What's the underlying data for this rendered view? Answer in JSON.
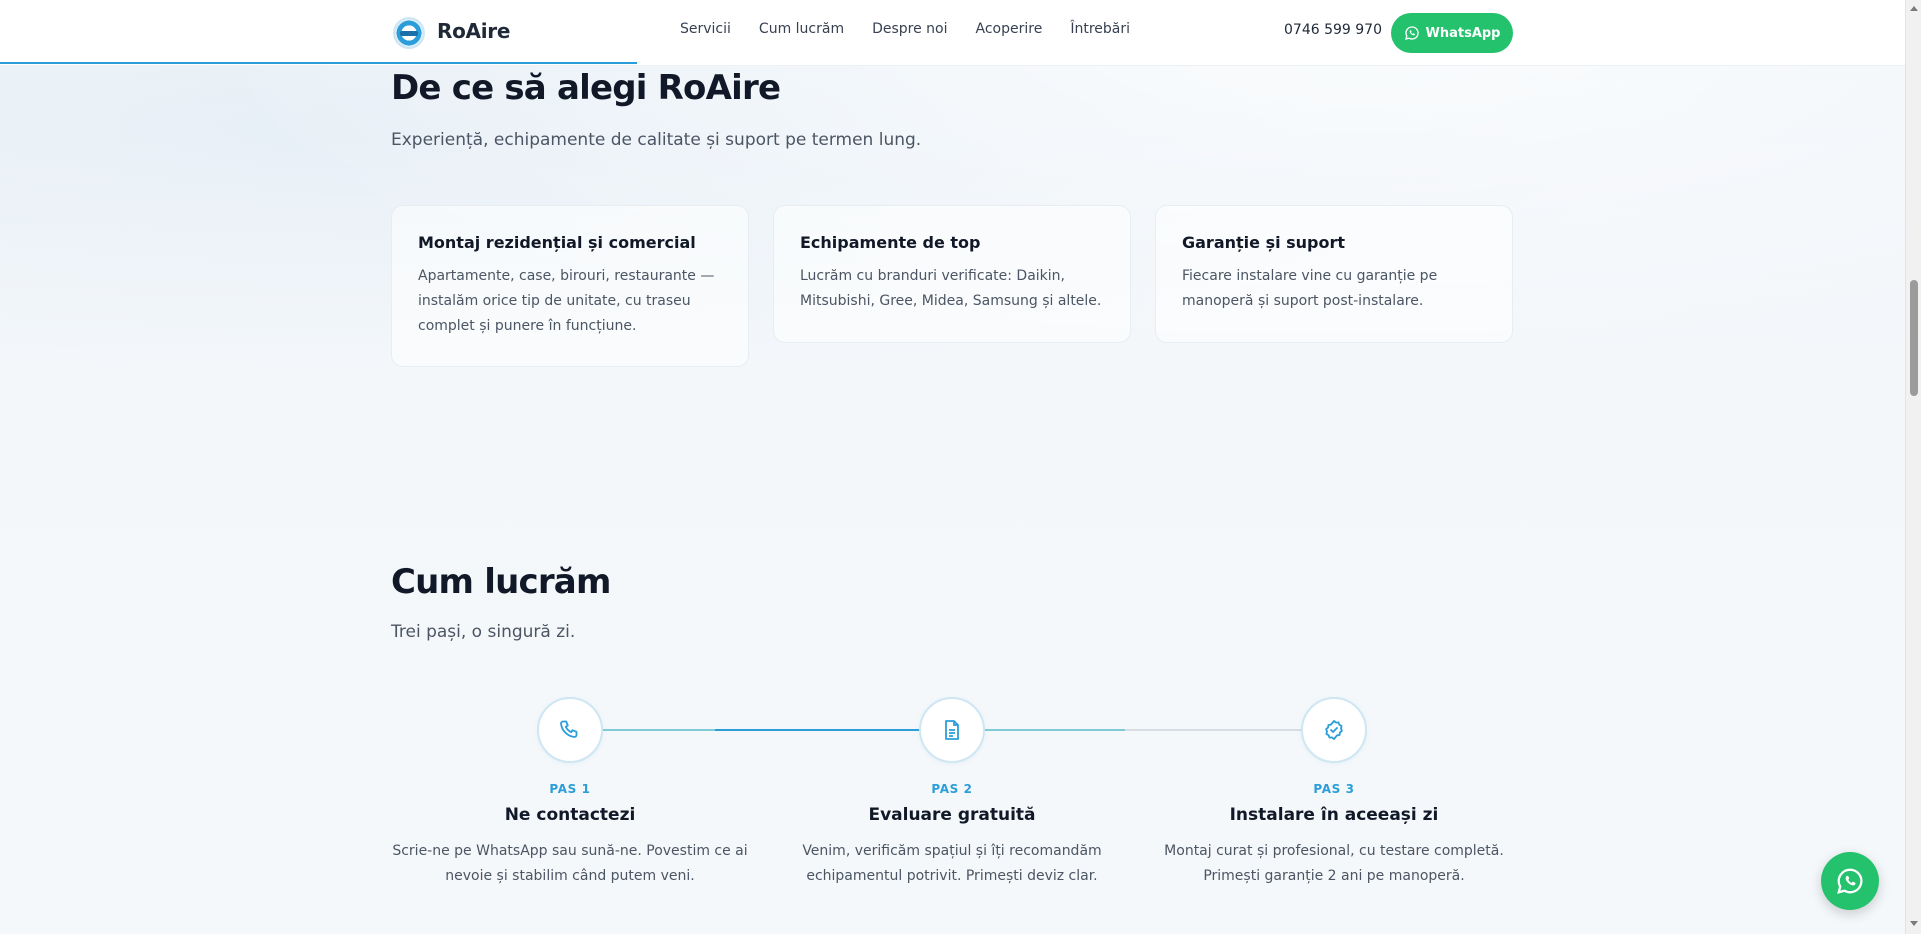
{
  "header": {
    "brand": "RoAire",
    "nav": [
      "Servicii",
      "Cum lucrăm",
      "Despre noi",
      "Acoperire",
      "Întrebări"
    ],
    "phone": "0746 599 970",
    "whatsapp_label": "WhatsApp"
  },
  "why": {
    "title": "De ce să alegi RoAire",
    "subtitle": "Experiență, echipamente de calitate și suport pe termen lung.",
    "cards": [
      {
        "title": "Montaj rezidențial și comercial",
        "text": "Apartamente, case, birouri, restaurante — instalăm orice tip de unitate, cu traseu complet și punere în funcțiune."
      },
      {
        "title": "Echipamente de top",
        "text": "Lucrăm cu branduri verificate: Daikin, Mitsubishi, Gree, Midea, Samsung și altele."
      },
      {
        "title": "Garanție și suport",
        "text": "Fiecare instalare vine cu garanție pe manoperă și suport post-instalare."
      }
    ]
  },
  "how": {
    "title": "Cum lucrăm",
    "subtitle": "Trei pași, o singură zi.",
    "steps": [
      {
        "label": "PAS 1",
        "title": "Ne contactezi",
        "text": "Scrie-ne pe WhatsApp sau sună-ne. Povestim ce ai nevoie și stabilim când putem veni.",
        "icon": "phone-icon"
      },
      {
        "label": "PAS 2",
        "title": "Evaluare gratuită",
        "text": "Venim, verificăm spațiul și îți recomandăm echipamentul potrivit. Primești deviz clar.",
        "icon": "document-icon"
      },
      {
        "label": "PAS 3",
        "title": "Instalare în aceeași zi",
        "text": "Montaj curat și profesional, cu testare completă. Primești garanție 2 ani pe manoperă.",
        "icon": "badge-check-icon"
      }
    ]
  },
  "colors": {
    "accent": "#2b9ed9",
    "whatsapp": "#25c26e",
    "text": "#111827"
  }
}
